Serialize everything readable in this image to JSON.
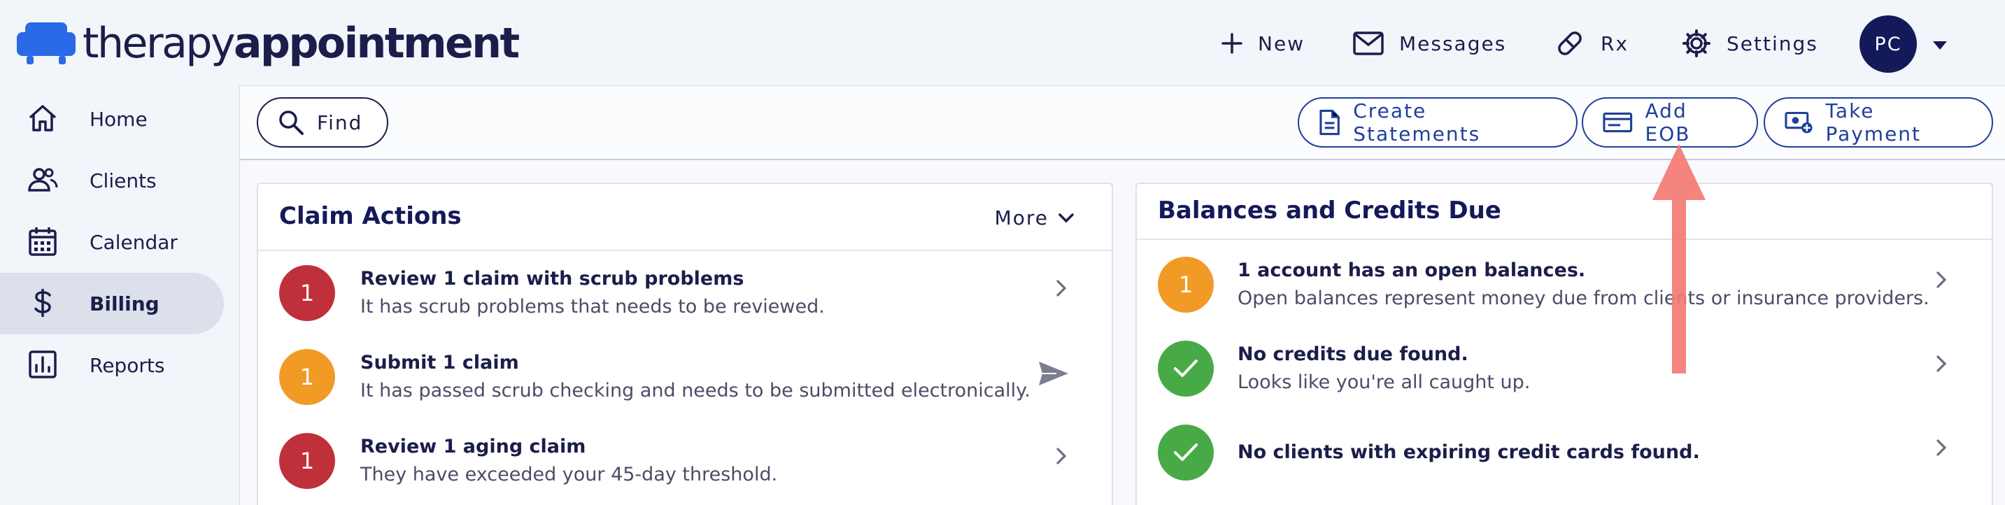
{
  "brand": {
    "name_light": "therapy",
    "name_bold": "appointment"
  },
  "header_nav": {
    "new": "New",
    "messages": "Messages",
    "rx": "Rx",
    "settings": "Settings",
    "avatar_initials": "PC"
  },
  "sidebar": {
    "items": [
      {
        "label": "Home",
        "icon": "home-icon"
      },
      {
        "label": "Clients",
        "icon": "clients-icon"
      },
      {
        "label": "Calendar",
        "icon": "calendar-icon"
      },
      {
        "label": "Billing",
        "icon": "dollar-icon",
        "active": true
      },
      {
        "label": "Reports",
        "icon": "reports-icon"
      }
    ]
  },
  "toolbar": {
    "find": "Find",
    "create_statements": "Create Statements",
    "add_eob": "Add EOB",
    "take_payment": "Take Payment"
  },
  "claim_actions": {
    "title": "Claim Actions",
    "more": "More",
    "rows": [
      {
        "count": "1",
        "title": "Review 1 claim with scrub problems",
        "desc": "It has scrub problems that needs to be reviewed."
      },
      {
        "count": "1",
        "title": "Submit 1 claim",
        "desc": "It has passed scrub checking and needs to be submitted electronically."
      },
      {
        "count": "1",
        "title": "Review 1 aging claim",
        "desc": "They have exceeded your 45-day threshold."
      }
    ]
  },
  "balances": {
    "title": "Balances and Credits Due",
    "rows": [
      {
        "count": "1",
        "title": "1 account has an open balances.",
        "desc": "Open balances represent money due from clients or insurance providers."
      },
      {
        "title": "No credits due found.",
        "desc": "Looks like you're all caught up."
      },
      {
        "title": "No clients with expiring credit cards found."
      }
    ]
  },
  "colors": {
    "navy": "#14195a",
    "accent_blue": "#1f3f9c",
    "logo_blue": "#2b6ae6",
    "badge_red": "#c0303a",
    "badge_orange": "#f29a26",
    "badge_green": "#47aa47",
    "annotation_arrow": "#f47a74"
  }
}
